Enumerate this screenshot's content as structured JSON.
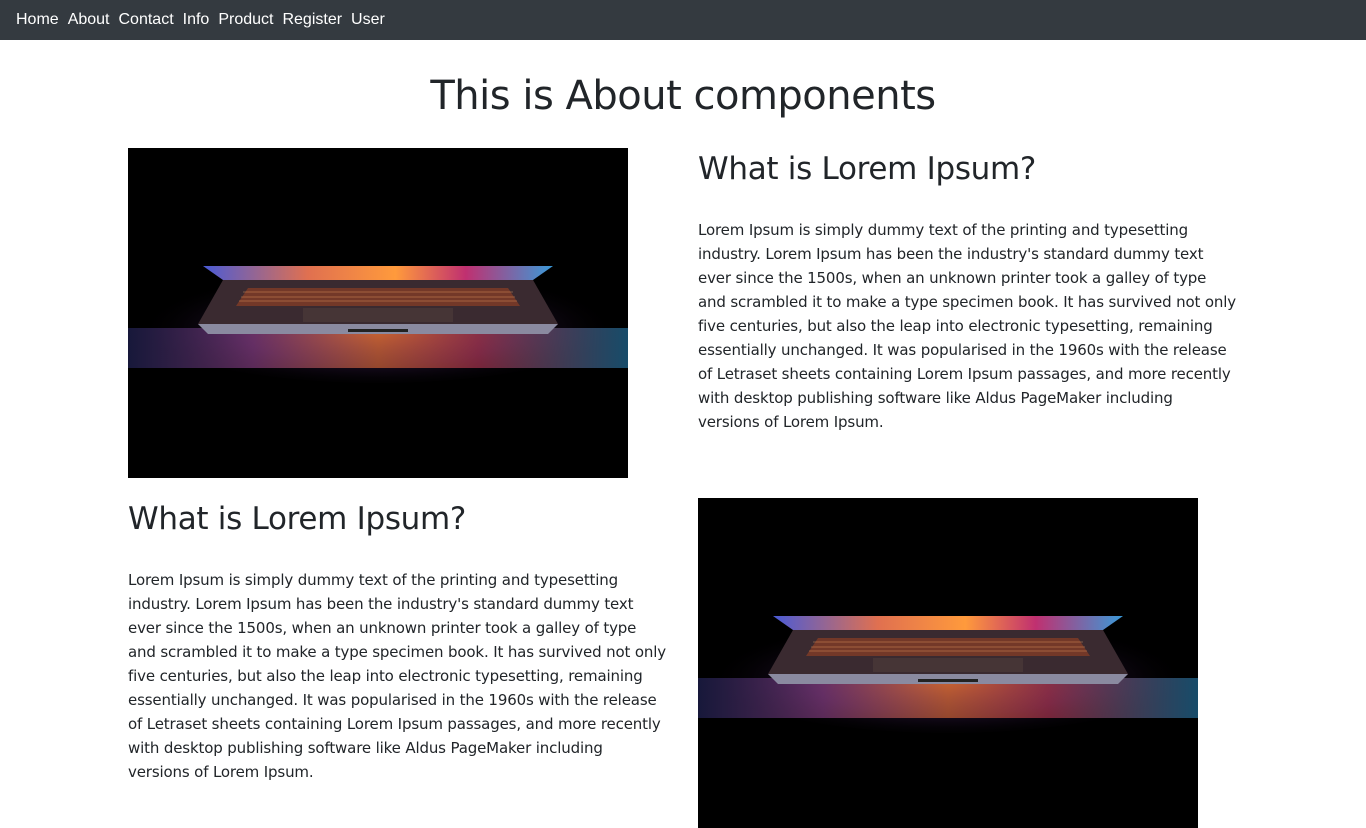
{
  "nav": {
    "items": [
      {
        "label": "Home"
      },
      {
        "label": "About"
      },
      {
        "label": "Contact"
      },
      {
        "label": "Info"
      },
      {
        "label": "Product"
      },
      {
        "label": "Register"
      },
      {
        "label": "User"
      }
    ]
  },
  "page": {
    "title": "This is About components"
  },
  "sections": [
    {
      "heading": "What is Lorem Ipsum?",
      "body": "Lorem Ipsum is simply dummy text of the printing and typesetting industry. Lorem Ipsum has been the industry's standard dummy text ever since the 1500s, when an unknown printer took a galley of type and scrambled it to make a type specimen book. It has survived not only five centuries, but also the leap into electronic typesetting, remaining essentially unchanged. It was popularised in the 1960s with the release of Letraset sheets containing Lorem Ipsum passages, and more recently with desktop publishing software like Aldus PageMaker including versions of Lorem Ipsum.",
      "image": "laptop-photo"
    },
    {
      "heading": "What is Lorem Ipsum?",
      "body": "Lorem Ipsum is simply dummy text of the printing and typesetting industry. Lorem Ipsum has been the industry's standard dummy text ever since the 1500s, when an unknown printer took a galley of type and scrambled it to make a type specimen book. It has survived not only five centuries, but also the leap into electronic typesetting, remaining essentially unchanged. It was popularised in the 1960s with the release of Letraset sheets containing Lorem Ipsum passages, and more recently with desktop publishing software like Aldus PageMaker including versions of Lorem Ipsum.",
      "image": "laptop-photo"
    }
  ],
  "colors": {
    "navbar_bg": "#343a40",
    "nav_text": "#ffffff",
    "text": "#212529",
    "photo_bg": "#000000"
  }
}
